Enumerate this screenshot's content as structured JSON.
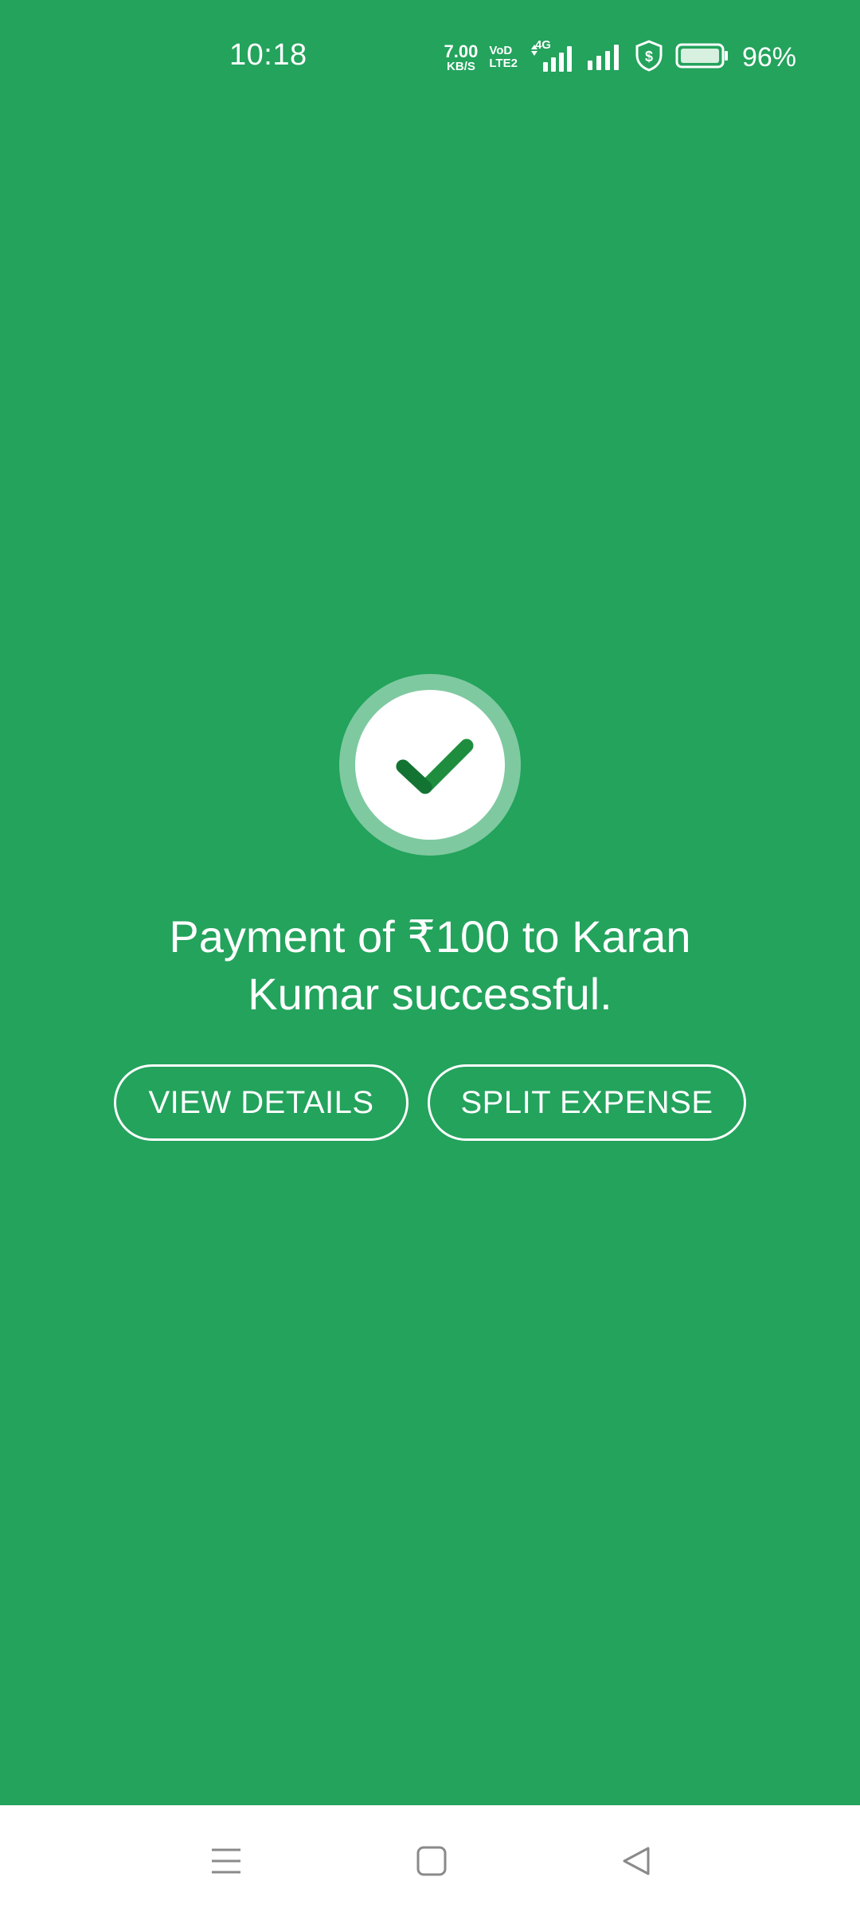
{
  "status_bar": {
    "time": "10:18",
    "net_speed_value": "7.00",
    "net_speed_unit": "KB/S",
    "volte_top": "VoD",
    "volte_bottom": "LTE2",
    "network_type": "4G",
    "battery_percent": "96%",
    "icons": [
      "network-speed",
      "volte-icon",
      "signal-4g-icon",
      "signal-icon",
      "security-shield-icon",
      "battery-icon"
    ]
  },
  "success": {
    "icon": "checkmark-icon",
    "message": "Payment of ₹100 to Karan Kumar successful."
  },
  "actions": {
    "view_details_label": "VIEW DETAILS",
    "split_expense_label": "SPLIT EXPENSE"
  },
  "nav_bar": {
    "icons": [
      "menu-icon",
      "home-icon",
      "back-icon"
    ]
  },
  "colors": {
    "background": "#23a35c",
    "check_green": "#1e8e3e",
    "check_dark_green": "#137333",
    "text": "#ffffff"
  }
}
